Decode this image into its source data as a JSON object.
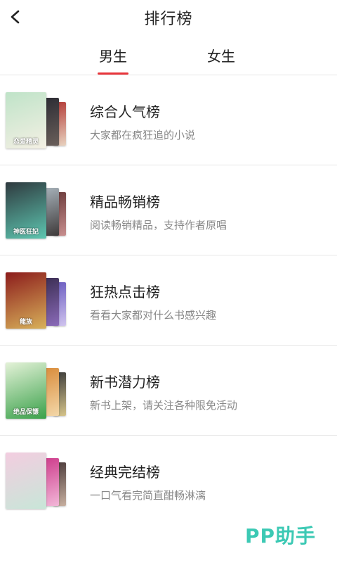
{
  "header": {
    "title": "排行榜",
    "back_icon": "chevron-left-icon"
  },
  "tabs": [
    {
      "label": "男生",
      "selected": true
    },
    {
      "label": "女生",
      "selected": false
    }
  ],
  "accent_color": "#e8343a",
  "rankings": [
    {
      "title": "综合人气榜",
      "description": "大家都在疯狂追的小说",
      "covers": [
        {
          "text": "恋爱精灵",
          "colors": [
            "#bfe3c8",
            "#f4f0e4"
          ]
        },
        {
          "text": "",
          "colors": [
            "#2b2b33",
            "#6a5f5a"
          ]
        },
        {
          "text": "",
          "colors": [
            "#b23a36",
            "#e8d3c0"
          ]
        }
      ]
    },
    {
      "title": "精品畅销榜",
      "description": "阅读畅销精品，支持作者原唱",
      "covers": [
        {
          "text": "神医狂妃",
          "colors": [
            "#2f3a3f",
            "#5dc6b0"
          ]
        },
        {
          "text": "",
          "colors": [
            "#a9b4bc",
            "#3e3a3a"
          ]
        },
        {
          "text": "",
          "colors": [
            "#6b3b3b",
            "#c88f8f"
          ]
        }
      ]
    },
    {
      "title": "狂热点击榜",
      "description": "看看大家都对什么书感兴趣",
      "covers": [
        {
          "text": "龍族",
          "colors": [
            "#8c1c1c",
            "#d8b15a"
          ]
        },
        {
          "text": "",
          "colors": [
            "#3a2d52",
            "#8a6ab8"
          ]
        },
        {
          "text": "",
          "colors": [
            "#6a5cc0",
            "#d0c4ee"
          ]
        }
      ]
    },
    {
      "title": "新书潜力榜",
      "description": "新书上架，请关注各种限免活动",
      "covers": [
        {
          "text": "绝品保镖",
          "colors": [
            "#e4f2d8",
            "#3aa14a"
          ]
        },
        {
          "text": "",
          "colors": [
            "#d98b3a",
            "#f3d7a8"
          ]
        },
        {
          "text": "",
          "colors": [
            "#3a3a3a",
            "#d6c48a"
          ]
        }
      ]
    },
    {
      "title": "经典完结榜",
      "description": "一口气看完简直酣畅淋漓",
      "covers": [
        {
          "text": "",
          "colors": [
            "#f3cde0",
            "#c8e6d8"
          ]
        },
        {
          "text": "",
          "colors": [
            "#cd3a8a",
            "#f2b7d8"
          ]
        },
        {
          "text": "",
          "colors": [
            "#4a3a3a",
            "#c8b0a0"
          ]
        }
      ]
    }
  ],
  "watermark": "PP助手"
}
